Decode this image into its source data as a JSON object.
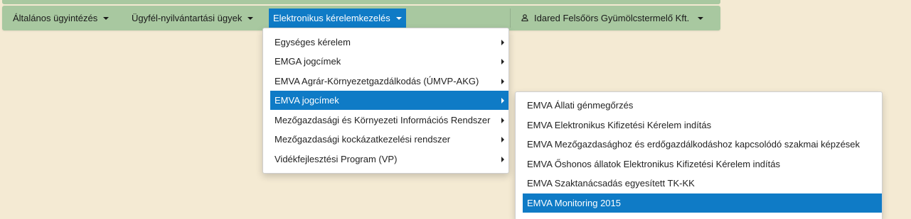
{
  "navbar": {
    "items": [
      {
        "label": "Általános ügyintézés"
      },
      {
        "label": "Ügyfél-nyilvántartási ügyek"
      },
      {
        "label": "Elektronikus kérelemkezelés"
      }
    ],
    "user": {
      "label": "Idared Felsőörs Gyümölcstermelő Kft.",
      "icon": "user-icon"
    }
  },
  "menu": {
    "items": [
      {
        "label": "Egységes kérelem"
      },
      {
        "label": "EMGA jogcímek"
      },
      {
        "label": "EMVA Agrár-Környezetgazdálkodás (ÚMVP-AKG)"
      },
      {
        "label": "EMVA jogcímek"
      },
      {
        "label": "Mezőgazdasági és Környezeti Információs Rendszer"
      },
      {
        "label": "Mezőgazdasági kockázatkezelési rendszer"
      },
      {
        "label": "Vidékfejlesztési Program (VP)"
      }
    ]
  },
  "submenu": {
    "items": [
      {
        "label": "EMVA Állati génmegőrzés"
      },
      {
        "label": "EMVA Elektronikus Kifizetési Kérelem indítás"
      },
      {
        "label": "EMVA Mezőgazdasághoz és erdőgazdálkodáshoz kapcsolódó szakmai képzések"
      },
      {
        "label": "EMVA Őshonos állatok Elektronikus Kifizetési Kérelem indítás"
      },
      {
        "label": "EMVA Szaktanácsadás egyesített TK-KK"
      },
      {
        "label": "EMVA Monitoring 2015"
      }
    ]
  },
  "colors": {
    "navbar_bg": "#a8c8a0",
    "page_bg": "#f4ead3",
    "accent": "#0f7bc6"
  }
}
